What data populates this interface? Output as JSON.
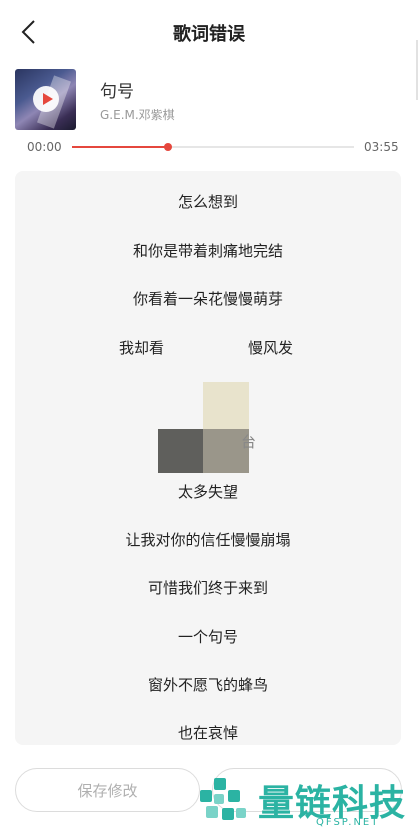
{
  "header": {
    "title": "歌词错误",
    "back_icon": "chevron-left-icon"
  },
  "song": {
    "name": "句号",
    "artist": "G.E.M.邓紫棋",
    "play_icon": "play-icon"
  },
  "progress": {
    "current": "00:00",
    "total": "03:55",
    "fraction": 0.34,
    "accent_color": "#e5473d"
  },
  "lyrics": {
    "lines": [
      "怎么想到",
      "和你是带着刺痛地完结",
      "你看着一朵花慢慢萌芽",
      "我却看",
      "慢风发",
      "太多失望",
      "让我对你的信任慢慢崩塌",
      "可惜我们终于来到",
      "一个句号",
      "窗外不愿飞的蜂鸟",
      "也在哀悼"
    ],
    "partial_char": "台"
  },
  "actions": {
    "save_label": "保存修改"
  },
  "watermark": {
    "text": "量链科技",
    "sub": "QFSP.NET"
  }
}
